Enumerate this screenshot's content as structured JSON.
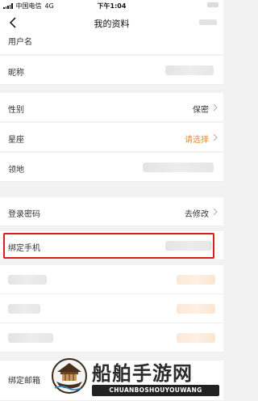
{
  "status_bar": {
    "carrier": "中国电信",
    "network": "4G",
    "time": "下午1:04"
  },
  "navbar": {
    "title": "我的资料"
  },
  "rows": {
    "username": {
      "label": "用户名"
    },
    "nickname": {
      "label": "昵称"
    },
    "gender": {
      "label": "性别",
      "value": "保密"
    },
    "zodiac": {
      "label": "星座",
      "value": "请选择"
    },
    "territory": {
      "label": "领地"
    },
    "password": {
      "label": "登录密码",
      "value": "去修改"
    },
    "bind_phone": {
      "label": "绑定手机"
    },
    "bind_email": {
      "label": "绑定邮箱"
    }
  },
  "colors": {
    "accent": "#f08a24",
    "highlight": "#d8211b"
  },
  "watermark": {
    "name": "船舶手游网",
    "domain": "CHUANBOSHOUYOUWANG"
  }
}
